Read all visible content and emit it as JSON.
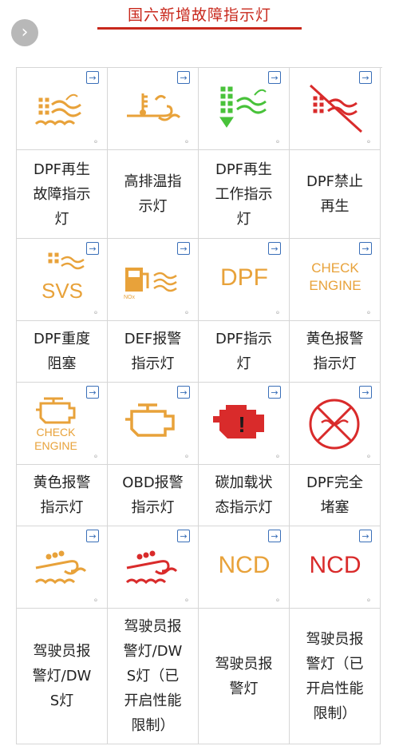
{
  "header": {
    "title": "国六新增故障指示灯",
    "back_glyph": "›"
  },
  "colors": {
    "amber": "#e8a23a",
    "green": "#48c23a",
    "red": "#d92b2b",
    "title": "#c8281c"
  },
  "share_glyph": "→",
  "rows": [
    [
      {
        "label": "DPF再生\n故障指示\n灯",
        "icon": "dpf-regen-fault-icon"
      },
      {
        "label": "高排温指\n示灯",
        "icon": "high-exhaust-temp-icon"
      },
      {
        "label": "DPF再生\n工作指示\n灯",
        "icon": "dpf-regen-active-icon"
      },
      {
        "label": "DPF禁止\n再生",
        "icon": "dpf-regen-inhibit-icon"
      }
    ],
    [
      {
        "label": "DPF重度\n阻塞",
        "icon": "svs-icon",
        "icon_text": "SVS"
      },
      {
        "label": "DEF报警\n指示灯",
        "icon": "def-fuel-pump-icon",
        "icon_text": "NOx"
      },
      {
        "label": "DPF指示\n灯",
        "icon": "dpf-text-icon",
        "icon_text": "DPF"
      },
      {
        "label": "黄色报警\n指示灯",
        "icon": "check-engine-text-icon",
        "icon_text": "CHECK\nENGINE"
      }
    ],
    [
      {
        "label": "黄色报警\n指示灯",
        "icon": "check-engine-symbol-icon",
        "icon_text": "CHECK\nENGINE"
      },
      {
        "label": "OBD报警\n指示灯",
        "icon": "engine-outline-icon"
      },
      {
        "label": "碳加载状\n态指示灯",
        "icon": "red-engine-warning-icon"
      },
      {
        "label": "DPF完全\n堵塞",
        "icon": "dpf-blocked-icon"
      }
    ],
    [
      {
        "label": "驾驶员报\n警灯/DW\nS灯",
        "icon": "driver-warning-amber-icon"
      },
      {
        "label": "驾驶员报\n警灯/DW\nS灯（已\n开启性能\n限制）",
        "icon": "driver-warning-red-icon"
      },
      {
        "label": "驾驶员报\n警灯",
        "icon": "ncd-amber-icon",
        "icon_text": "NCD"
      },
      {
        "label": "驾驶员报\n警灯（已\n开启性能\n限制）",
        "icon": "ncd-red-icon",
        "icon_text": "NCD"
      }
    ]
  ]
}
